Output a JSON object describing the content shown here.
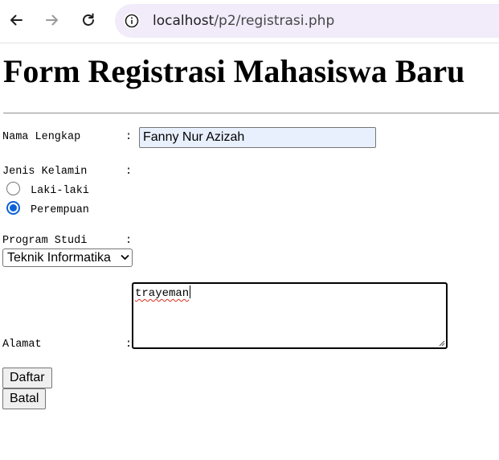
{
  "browser": {
    "url_host": "localhost",
    "url_path": "/p2/registrasi.php",
    "icons": [
      "back-arrow-icon",
      "forward-arrow-icon",
      "reload-icon",
      "site-info-icon"
    ]
  },
  "page": {
    "title": "Form Registrasi Mahasiswa Baru"
  },
  "form": {
    "nama": {
      "label": "Nama Lengkap",
      "colon": ":",
      "value": "Fanny Nur Azizah"
    },
    "jenis_kelamin": {
      "label": "Jenis Kelamin",
      "colon": ":",
      "options": [
        {
          "label": "Laki-laki",
          "checked": false
        },
        {
          "label": "Perempuan",
          "checked": true
        }
      ]
    },
    "prodi": {
      "label": "Program Studi",
      "colon": ":",
      "selected": "Teknik Informatika"
    },
    "alamat": {
      "label": "Alamat",
      "colon": ":",
      "value": "trayeman"
    },
    "buttons": {
      "submit": "Daftar",
      "reset": "Batal"
    }
  },
  "colors": {
    "address_bar": "#f1ebfa",
    "autofill_bg": "#e8f0fe",
    "radio_accent": "#0b62d6"
  }
}
